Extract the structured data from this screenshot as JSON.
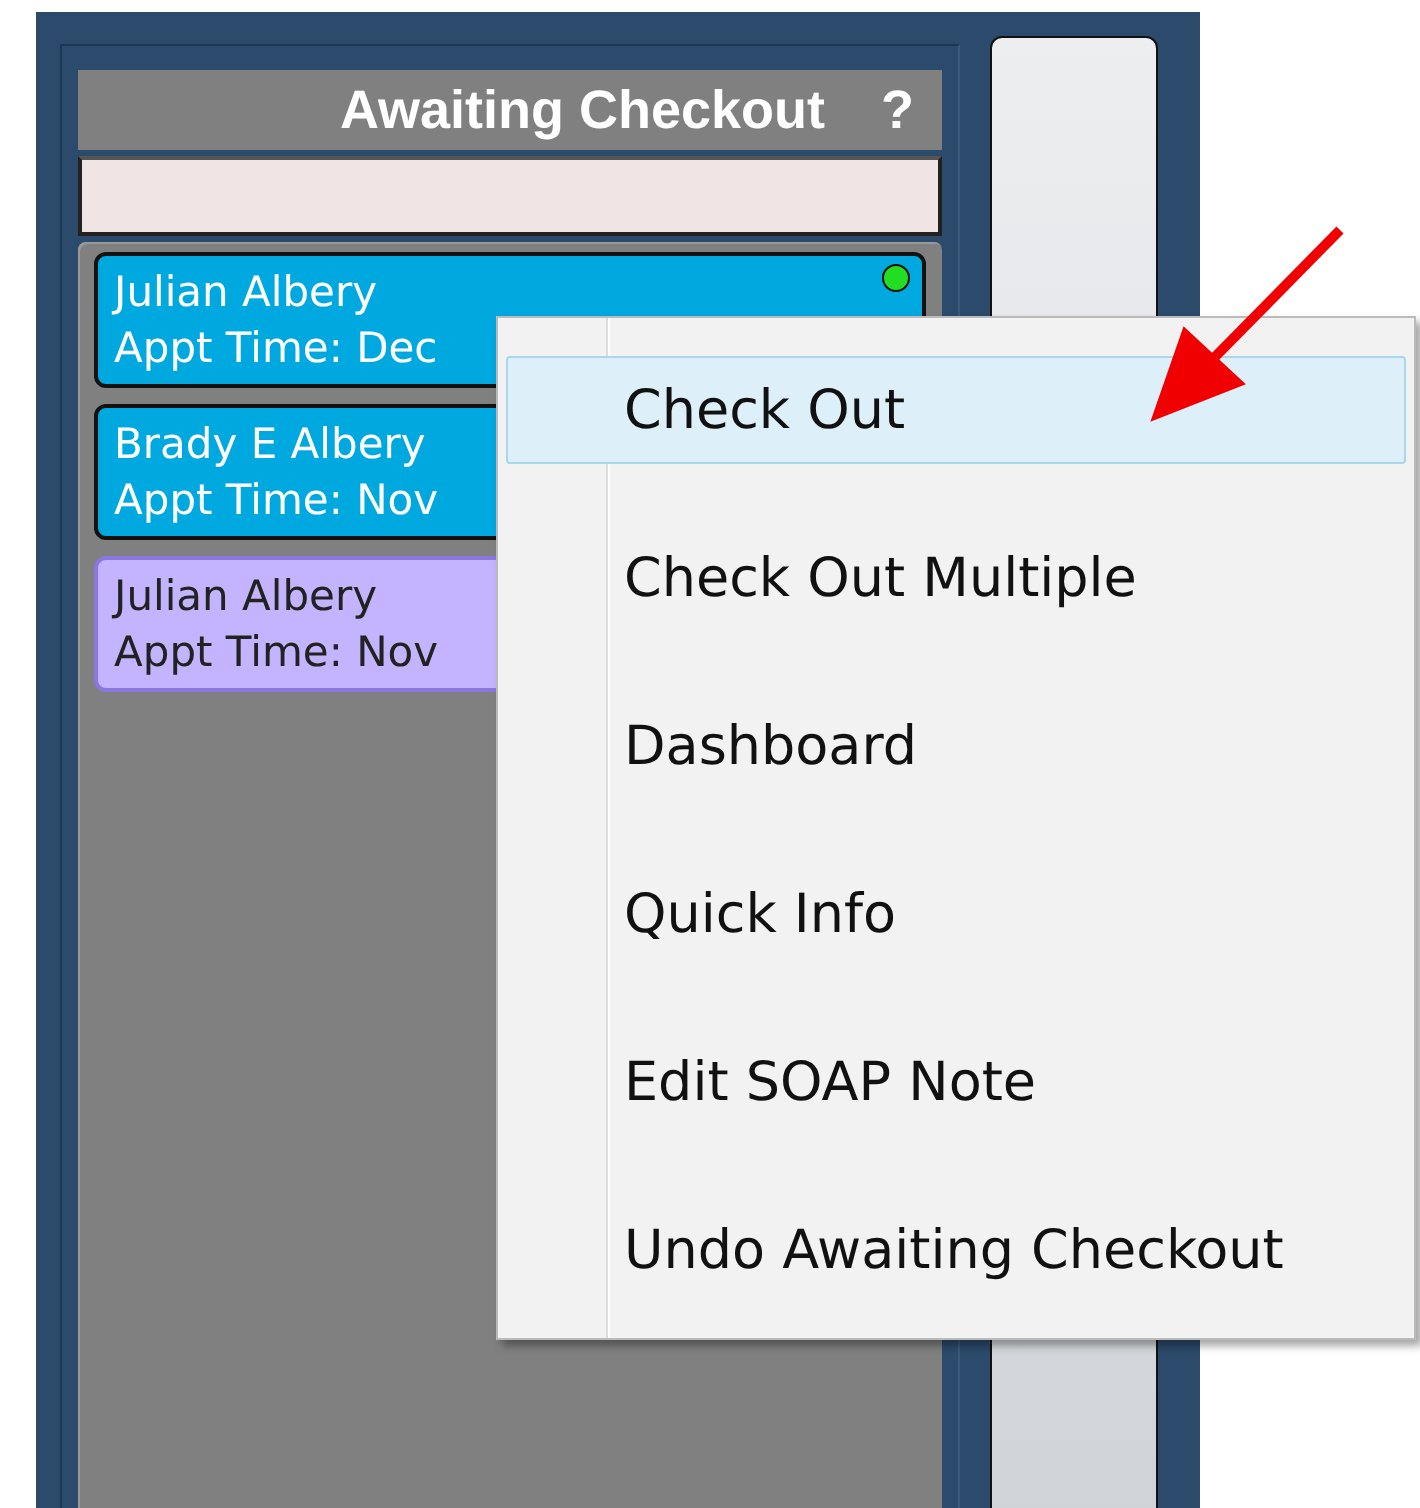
{
  "panel": {
    "title": "Awaiting Checkout",
    "help": "?"
  },
  "cards": [
    {
      "name": "Julian Albery",
      "appt": "Appt Time: Dec",
      "color": "#00a8e0",
      "indicator": true
    },
    {
      "name": "Brady E Albery",
      "appt": "Appt Time: Nov",
      "color": "#00a8e0"
    },
    {
      "name": "Julian Albery",
      "appt": "Appt Time: Nov",
      "color": "#c4b4ff"
    }
  ],
  "context_menu": [
    {
      "label": "Check Out",
      "selected": true
    },
    {
      "label": "Check Out Multiple",
      "selected": false
    },
    {
      "label": "Dashboard",
      "selected": false
    },
    {
      "label": "Quick Info",
      "selected": false
    },
    {
      "label": "Edit SOAP Note",
      "selected": false
    },
    {
      "label": "Undo Awaiting Checkout",
      "selected": false
    }
  ]
}
